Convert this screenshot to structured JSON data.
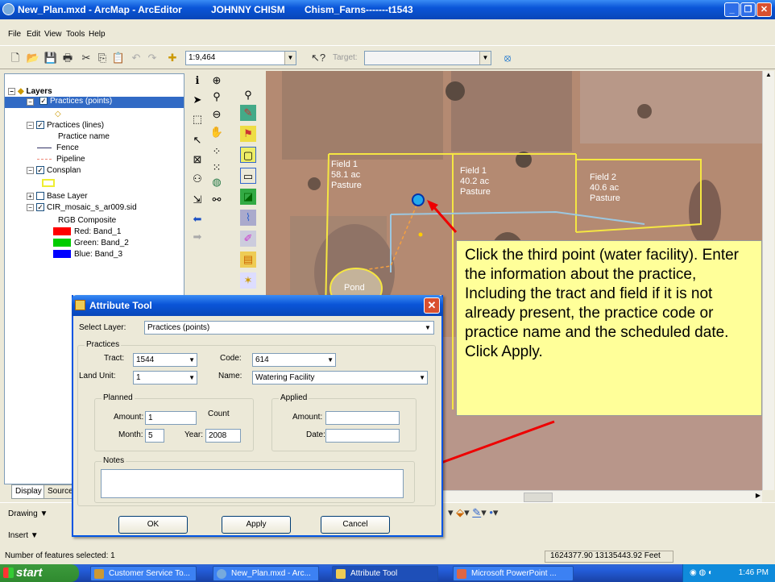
{
  "window": {
    "title": "New_Plan.mxd - ArcMap - ArcEditor",
    "user": "JOHNNY CHISM",
    "farm": "Chism_Farns-------t1543"
  },
  "menu": [
    "File",
    "Edit",
    "View",
    "Tools",
    "Help"
  ],
  "toolbar": {
    "scale": "1:9,464",
    "target_label": "Target:"
  },
  "toc": {
    "root": "Layers",
    "items": [
      {
        "label": "Practices (points)",
        "selected": true
      },
      {
        "label": "Practices (lines)"
      },
      {
        "label": "Practice name"
      },
      {
        "label": "Fence"
      },
      {
        "label": "Pipeline"
      },
      {
        "label": "Consplan"
      },
      {
        "label": "Base Layer"
      },
      {
        "label": "CIR_mosaic_s_ar009.sid"
      },
      {
        "label": "RGB Composite"
      },
      {
        "label": "Red:   Band_1"
      },
      {
        "label": "Green: Band_2"
      },
      {
        "label": "Blue:  Band_3"
      }
    ],
    "tabs": [
      "Display",
      "Source"
    ]
  },
  "map": {
    "fields": [
      "Field 1\n58.1 ac\nPasture",
      "Field 1\n40.2 ac\nPasture",
      "Field 2\n40.6 ac\nPasture"
    ],
    "pond": "Pond"
  },
  "callout": "Click the third point (water facility). Enter the information about the practice, Including the tract and field if it is not already present, the practice code or practice name and the scheduled date. Click Apply.",
  "dialog": {
    "title": "Attribute Tool",
    "select_layer_label": "Select Layer:",
    "select_layer_value": "Practices (points)",
    "practices_label": "Practices",
    "tract_label": "Tract:",
    "tract_value": "1544",
    "code_label": "Code:",
    "code_value": "614",
    "land_unit_label": "Land Unit:",
    "land_unit_value": "1",
    "name_label": "Name:",
    "name_value": "Watering Facility",
    "planned_label": "Planned",
    "amount_label": "Amount:",
    "amount_value": "1",
    "count_label": "Count",
    "month_label": "Month:",
    "month_value": "5",
    "year_label": "Year:",
    "year_value": "2008",
    "applied_label": "Applied",
    "applied_amount_label": "Amount:",
    "date_label": "Date:",
    "notes_label": "Notes",
    "ok": "OK",
    "apply": "Apply",
    "cancel": "Cancel"
  },
  "bottom": {
    "drawing": "Drawing",
    "insert": "Insert"
  },
  "status": {
    "features": "Number of features selected: 1",
    "coords": "1624377.90  13135443.92 Feet"
  },
  "taskbar": {
    "start": "start",
    "tasks": [
      "Customer Service To...",
      "New_Plan.mxd - Arc...",
      "Attribute Tool",
      "Microsoft PowerPoint ..."
    ],
    "time": "1:46 PM"
  }
}
